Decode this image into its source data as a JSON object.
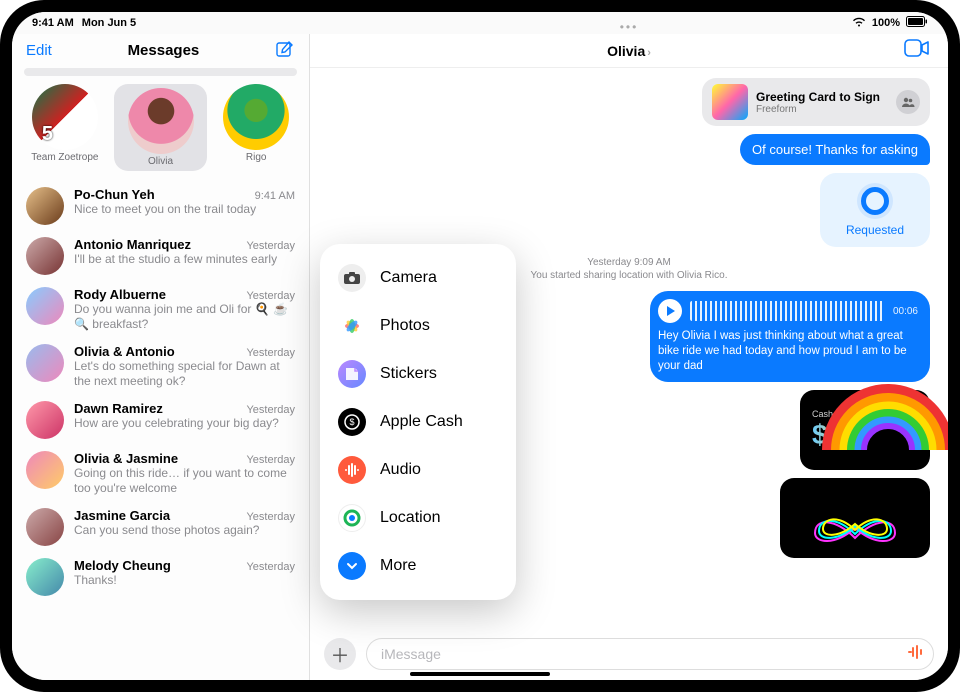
{
  "status": {
    "time": "9:41 AM",
    "date": "Mon Jun 5",
    "battery": "100%"
  },
  "sidebar": {
    "edit": "Edit",
    "title": "Messages",
    "pinned": [
      {
        "label": "Team Zoetrope"
      },
      {
        "label": "Olivia"
      },
      {
        "label": "Rigo"
      }
    ],
    "conversations": [
      {
        "name": "Po-Chun Yeh",
        "time": "9:41 AM",
        "snippet": "Nice to meet you on the trail today"
      },
      {
        "name": "Antonio Manriquez",
        "time": "Yesterday",
        "snippet": "I'll be at the studio a few minutes early"
      },
      {
        "name": "Rody Albuerne",
        "time": "Yesterday",
        "snippet": "Do you wanna join me and Oli for 🍳 ☕ 🔍 breakfast?"
      },
      {
        "name": "Olivia & Antonio",
        "time": "Yesterday",
        "snippet": "Let's do something special for Dawn at the next meeting ok?"
      },
      {
        "name": "Dawn Ramirez",
        "time": "Yesterday",
        "snippet": "How are you celebrating your big day?"
      },
      {
        "name": "Olivia & Jasmine",
        "time": "Yesterday",
        "snippet": "Going on this ride… if you want to come too you're welcome"
      },
      {
        "name": "Jasmine Garcia",
        "time": "Yesterday",
        "snippet": "Can you send those photos again?"
      },
      {
        "name": "Melody Cheung",
        "time": "Yesterday",
        "snippet": "Thanks!"
      }
    ]
  },
  "pane": {
    "title": "Olivia",
    "link": {
      "title": "Greeting Card to Sign",
      "sub": "Freeform"
    },
    "msg1": "Of course! Thanks for asking",
    "requested": "Requested",
    "timestamp": "Yesterday 9:09 AM",
    "system": "You started sharing location with Olivia Rico.",
    "audio_duration": "00:06",
    "audio_caption": "Hey Olivia I was just thinking about what a great bike ride we had today and how proud I am to be your dad",
    "cash_brand": "Cash",
    "cash_amount": "$15",
    "input_placeholder": "iMessage"
  },
  "popover": {
    "items": [
      {
        "label": "Camera"
      },
      {
        "label": "Photos"
      },
      {
        "label": "Stickers"
      },
      {
        "label": "Apple Cash"
      },
      {
        "label": "Audio"
      },
      {
        "label": "Location"
      },
      {
        "label": "More"
      }
    ]
  }
}
